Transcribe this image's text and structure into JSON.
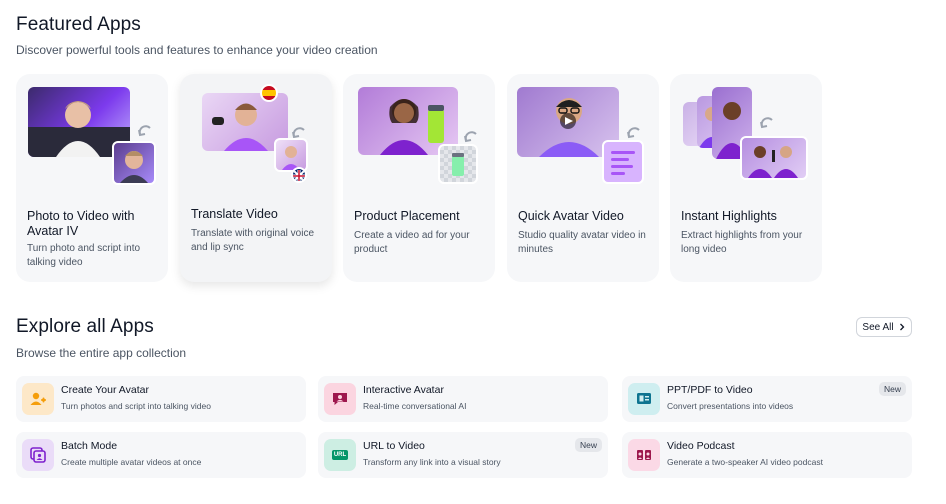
{
  "featured": {
    "title": "Featured Apps",
    "subtitle": "Discover powerful tools and features to enhance your video creation",
    "cards": [
      {
        "title": "Photo to Video with Avatar IV",
        "desc": "Turn photo and script into talking video"
      },
      {
        "title": "Translate Video",
        "desc": "Translate with original voice and lip sync"
      },
      {
        "title": "Product Placement",
        "desc": "Create a video ad for your product"
      },
      {
        "title": "Quick Avatar Video",
        "desc": "Studio quality avatar video in minutes"
      },
      {
        "title": "Instant Highlights",
        "desc": "Extract highlights from your long video"
      }
    ]
  },
  "explore": {
    "title": "Explore all Apps",
    "subtitle": "Browse the entire app collection",
    "see_all": "See All",
    "apps": [
      {
        "name": "Create Your Avatar",
        "desc": "Turn photos and script into talking video",
        "icon": "avatar-icon",
        "color": "#fde8c8",
        "badge": ""
      },
      {
        "name": "Interactive Avatar",
        "desc": "Real-time conversational AI",
        "icon": "chat-avatar-icon",
        "color": "#fbd5e0",
        "badge": ""
      },
      {
        "name": "PPT/PDF to Video",
        "desc": "Convert presentations into videos",
        "icon": "presentation-icon",
        "color": "#cfeef0",
        "badge": "New"
      },
      {
        "name": "Batch Mode",
        "desc": "Create multiple avatar videos at once",
        "icon": "batch-icon",
        "color": "#eadcf8",
        "badge": ""
      },
      {
        "name": "URL to Video",
        "desc": "Transform any link into a visual story",
        "icon": "url-icon",
        "color": "#cdeee3",
        "badge": "New"
      },
      {
        "name": "Video Podcast",
        "desc": "Generate a two-speaker AI video podcast",
        "icon": "podcast-icon",
        "color": "#fbd9e6",
        "badge": ""
      }
    ],
    "url_icon_text": "URL"
  }
}
